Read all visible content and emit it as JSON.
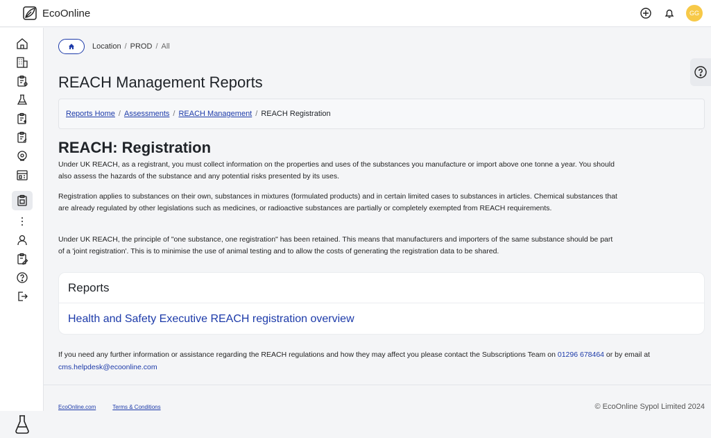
{
  "header": {
    "brand": "EcoOnline",
    "avatar_initials": "GG",
    "avatar_color": "#f7c948"
  },
  "sidebar": {
    "items": [
      {
        "icon": "home-icon"
      },
      {
        "icon": "building-icon"
      },
      {
        "icon": "clipboard-person-icon"
      },
      {
        "icon": "flask-icon"
      },
      {
        "icon": "clipboard-add-icon"
      },
      {
        "icon": "clipboard-edit-icon"
      },
      {
        "icon": "location-pin-icon"
      },
      {
        "icon": "calendar-icon"
      },
      {
        "icon": "clipboard-active-icon"
      },
      {
        "icon": "more-vertical-icon"
      },
      {
        "icon": "user-icon"
      },
      {
        "icon": "edit-document-icon"
      },
      {
        "icon": "help-icon"
      },
      {
        "icon": "logout-icon"
      }
    ],
    "bottom_icon": "flask-icon"
  },
  "location_crumb": {
    "location": "Location",
    "env": "PROD",
    "scope": "All"
  },
  "page": {
    "title": "REACH Management Reports",
    "breadcrumb": {
      "reports_home": "Reports Home",
      "assessments": "Assessments",
      "reach_management": "REACH Management",
      "current": "REACH Registration"
    },
    "section_title": "REACH: Registration",
    "paragraphs": [
      "Under UK REACH, as a registrant, you must collect information on the properties and uses of the substances you manufacture or import above one tonne a year. You should also assess the hazards of the substance and any potential risks presented by its uses.",
      "Registration applies to substances on their own, substances in mixtures (formulated products) and in certain limited cases to substances in articles. Chemical substances that are already regulated by other legislations such as medicines, or radioactive substances are partially or completely exempted from REACH requirements.",
      "Under UK REACH, the principle of \"one substance, one registration\" has been retained. This means that manufacturers and importers of the same substance should be part of a 'joint registration'. This is to minimise the use of animal testing and to allow the costs of generating the registration data to be shared."
    ],
    "reports": {
      "heading": "Reports",
      "link": "Health and Safety Executive REACH registration overview"
    },
    "contact": {
      "text_before": "If you need any further information or assistance regarding the REACH regulations and how they may affect you please contact the Subscriptions Team on ",
      "phone": "01296 678464",
      "text_mid": " or by email at ",
      "email": "cms.helpdesk@ecoonline.com"
    }
  },
  "footer": {
    "link1": "EcoOnline.com",
    "link2": "Terms & Conditions",
    "copyright": "© EcoOnline Sypol Limited 2024"
  },
  "colors": {
    "accent": "#1c3aa9",
    "background": "#f4f5f7"
  }
}
